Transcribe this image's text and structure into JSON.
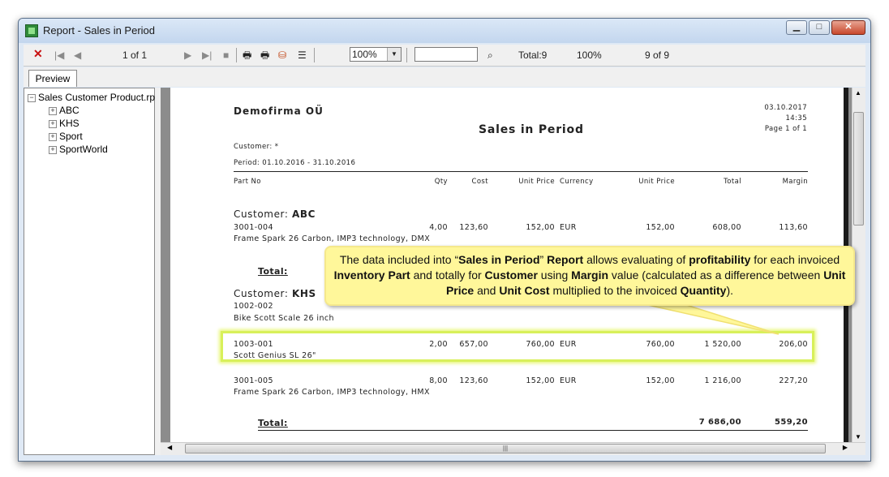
{
  "window": {
    "title": "Report - Sales in Period"
  },
  "toolbar": {
    "page_of": "1 of 1",
    "zoom": "100%",
    "total": "Total:9",
    "percent": "100%",
    "count": "9 of 9"
  },
  "tabs": {
    "preview": "Preview"
  },
  "tree": {
    "root": "Sales Customer Product.rpt",
    "items": [
      "ABC",
      "KHS",
      "Sport",
      "SportWorld"
    ]
  },
  "report": {
    "company": "Demofirma OÜ",
    "title": "Sales in Period",
    "date": "03.10.2017",
    "time": "14:35",
    "page": "Page 1 of 1",
    "customer_filter": "Customer: *",
    "period": "Period: 01.10.2016 - 31.10.2016",
    "headers": {
      "part_no": "Part No",
      "qty": "Qty",
      "cost": "Cost",
      "unit_price": "Unit Price",
      "currency": "Currency",
      "unit_price2": "Unit Price",
      "total": "Total",
      "margin": "Margin"
    },
    "customer_label": "Customer:",
    "customer_abc": "ABC",
    "customer_khs": "KHS",
    "rows": [
      {
        "part": "3001-004",
        "desc": "Frame Spark 26 Carbon, IMP3 technology, DMX",
        "qty": "4,00",
        "cost": "123,60",
        "unit_price": "152,00",
        "currency": "EUR",
        "unit_price2": "152,00",
        "total": "608,00",
        "margin": "113,60"
      },
      {
        "part": "1002-002",
        "desc": "Bike Scott Scale 26 inch"
      },
      {
        "part": "1003-001",
        "desc": "Scott Genius SL 26\"",
        "qty": "2,00",
        "cost": "657,00",
        "unit_price": "760,00",
        "currency": "EUR",
        "unit_price2": "760,00",
        "total": "1 520,00",
        "margin": "206,00"
      },
      {
        "part": "3001-005",
        "desc": "Frame Spark 26 Carbon, IMP3 technology, HMX",
        "qty": "8,00",
        "cost": "123,60",
        "unit_price": "152,00",
        "currency": "EUR",
        "unit_price2": "152,00",
        "total": "1 216,00",
        "margin": "227,20"
      }
    ],
    "total_label": "Total:",
    "grand_total": "7 686,00",
    "grand_margin": "559,20"
  },
  "callout": {
    "t1": "The data included into “",
    "b1": "Sales in Period",
    "t2": "” ",
    "b2": "Report",
    "t3": " allows evaluating of ",
    "b3": "profitability",
    "t4": " for each invoiced ",
    "b4": "Inventory Part",
    "t5": " and totally for ",
    "b5": "Customer",
    "t6": " using ",
    "b6": "Margin",
    "t7": " value (calculated as a difference between ",
    "b7": "Unit Price",
    "t8": " and ",
    "b8": "Unit Cost",
    "t9": " multiplied to the invoiced ",
    "b9": "Quantity",
    "t10": ")."
  },
  "colors": {
    "highlight": "#d8f05a",
    "callout_bg": "#fff79a",
    "close_button": "#c8472c"
  }
}
